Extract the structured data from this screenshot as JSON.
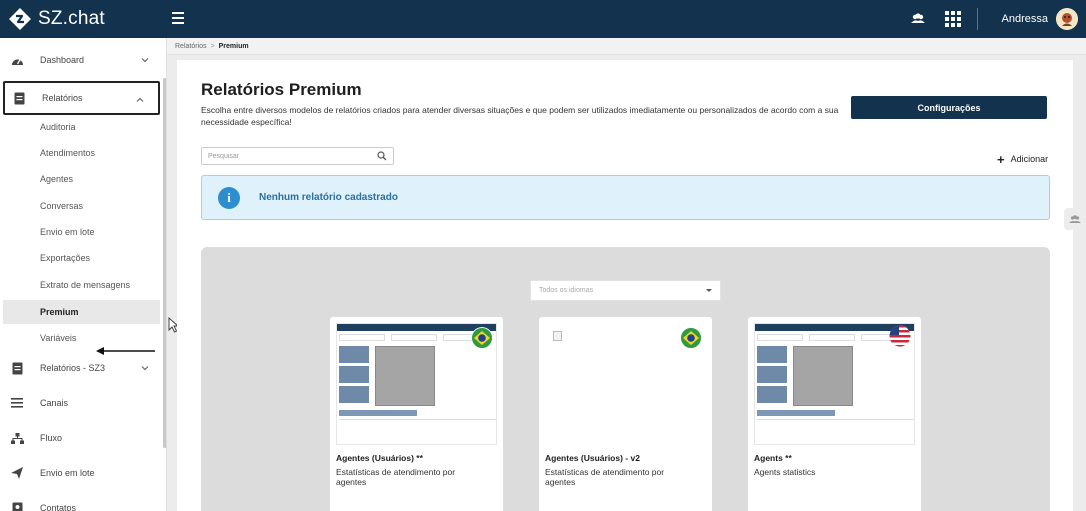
{
  "app": {
    "brand": "SZ.chat",
    "user": "Andressa"
  },
  "sidebar": {
    "items": [
      {
        "label": "Dashboard",
        "icon": "dashboard-icon"
      },
      {
        "label": "Relatórios",
        "icon": "report-icon"
      },
      {
        "label": "Relatórios - SZ3",
        "icon": "report-icon"
      },
      {
        "label": "Canais",
        "icon": "list-icon"
      },
      {
        "label": "Fluxo",
        "icon": "sitemap-icon"
      },
      {
        "label": "Envio em lote",
        "icon": "paper-plane-icon"
      },
      {
        "label": "Contatos",
        "icon": "address-book-icon"
      }
    ],
    "subitems": [
      {
        "label": "Auditoria"
      },
      {
        "label": "Atendimentos"
      },
      {
        "label": "Agentes"
      },
      {
        "label": "Conversas"
      },
      {
        "label": "Envio em lote"
      },
      {
        "label": "Exportações"
      },
      {
        "label": "Extrato de mensagens"
      },
      {
        "label": "Premium"
      },
      {
        "label": "Variáveis"
      }
    ]
  },
  "breadcrumb": {
    "parent": "Relatórios",
    "separator": ">",
    "current": "Premium"
  },
  "main": {
    "title": "Relatórios Premium",
    "description": "Escolha entre diversos modelos de relatórios criados para atender diversas situações e que podem ser utilizados imediatamente ou personalizados de acordo com a sua necessidade específica!",
    "config_button": "Configurações",
    "search_placeholder": "Pesquisar",
    "add_label": "Adicionar",
    "alert_text": "Nenhum relatório cadastrado",
    "language_select": "Todos os idiomas"
  },
  "cards": [
    {
      "title": "Agentes (Usuários) **",
      "subtitle": "Estatísticas de atendimento por agentes",
      "flag": "brazil-flag-icon"
    },
    {
      "title": "Agentes (Usuários) - v2",
      "subtitle": "Estatísticas de atendimento por agentes",
      "flag": "brazil-flag-icon"
    },
    {
      "title": "Agents **",
      "subtitle": "Agents statistics",
      "flag": "usa-flag-icon"
    }
  ],
  "colors": {
    "topbar": "#12324e",
    "alert_bg": "#dff1fb",
    "alert_icon": "#2d8ecf",
    "gallery_bg": "#dcdcdc"
  }
}
